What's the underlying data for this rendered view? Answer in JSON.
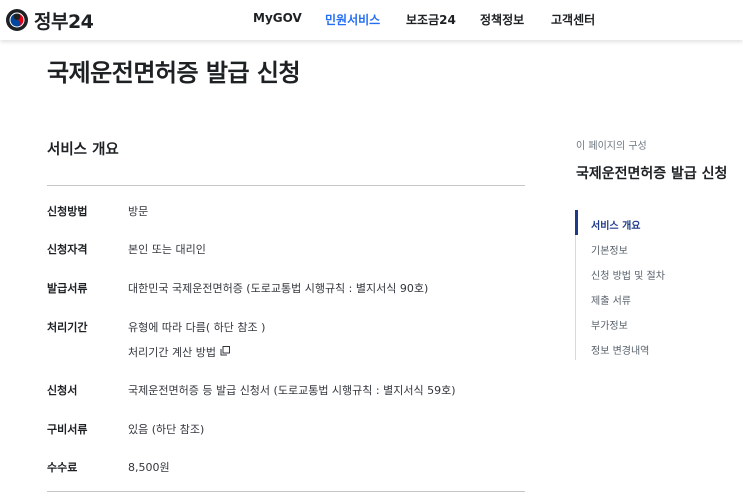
{
  "header": {
    "logo_text": "정부24",
    "nav": [
      "MyGOV",
      "민원서비스",
      "보조금24",
      "정책정보",
      "고객센터"
    ],
    "active_nav": "민원서비스",
    "accent_color": "#256ef4"
  },
  "page": {
    "title": "국제운전면허증 발급 신청"
  },
  "overview": {
    "title": "서비스 개요",
    "rows": [
      {
        "label": "신청방법",
        "value": "방문"
      },
      {
        "label": "신청자격",
        "value": "본인 또는 대리인"
      },
      {
        "label": "발급서류",
        "value": "대한민국 국제운전면허증 (도로교통법 시행규칙 : 별지서식 90호)"
      },
      {
        "label": "처리기간",
        "value": "유형에 따라 다름( 하단 참조 )",
        "link": "처리기간 계산 방법"
      },
      {
        "label": "신청서",
        "value": "국제운전면허증 등 발급 신청서 (도로교통법 시행규칙 : 별지서식 59호)"
      },
      {
        "label": "구비서류",
        "value": "있음 (하단 참조)"
      },
      {
        "label": "수수료",
        "value": "8,500원"
      }
    ]
  },
  "toc": {
    "caption": "이 페이지의 구성",
    "title": "국제운전면허증 발급 신청",
    "items": [
      "서비스 개요",
      "기본정보",
      "신청 방법 및 절차",
      "제출 서류",
      "부가정보",
      "정보 변경내역"
    ],
    "active": "서비스 개요",
    "active_color": "#1e3a8a"
  },
  "icons": {
    "logo": "taegeuk-logo-icon",
    "external": "new-window-icon"
  }
}
